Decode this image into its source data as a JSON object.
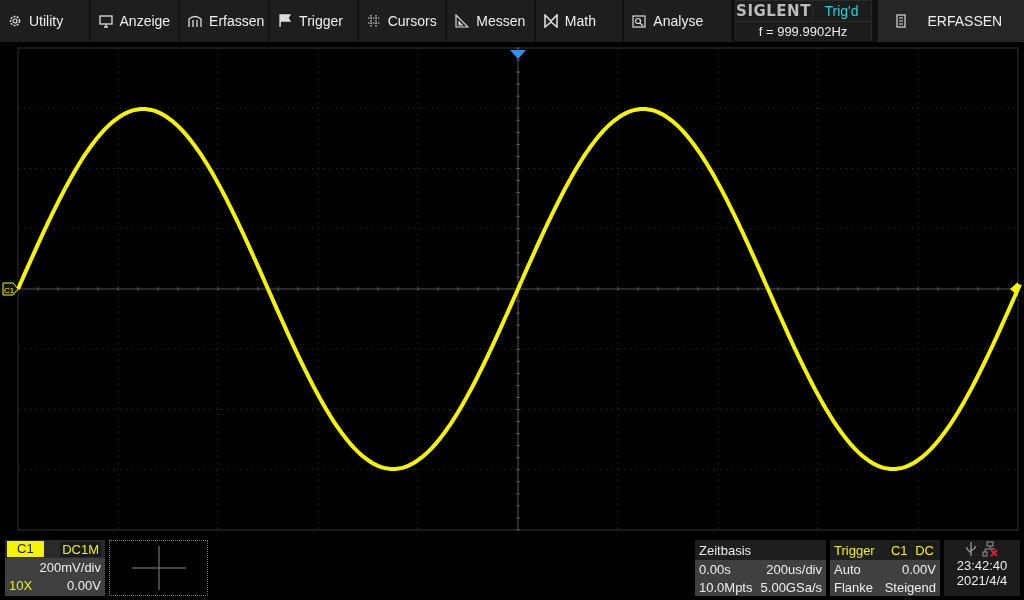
{
  "menu": [
    {
      "label": "Utility"
    },
    {
      "label": "Anzeige"
    },
    {
      "label": "Erfassen"
    },
    {
      "label": "Trigger"
    },
    {
      "label": "Cursors"
    },
    {
      "label": "Messen"
    },
    {
      "label": "Math"
    },
    {
      "label": "Analyse"
    }
  ],
  "brand": "SIGLENT",
  "trigger_status": "Trig'd",
  "frequency": "f = 999.9902Hz",
  "acquire_button": "ERFASSEN",
  "channel_marker": "C1",
  "channel": {
    "name": "C1",
    "coupling": "DC1M",
    "scale": "200mV/div",
    "probe": "10X",
    "offset": "0.00V"
  },
  "timebase": {
    "title": "Zeitbasis",
    "delay": "0.00s",
    "scale": "200us/div",
    "memory": "10.0Mpts",
    "sample_rate": "5.00GSa/s"
  },
  "trigger": {
    "title": "Trigger",
    "source": "C1",
    "coupling": "DC",
    "mode": "Auto",
    "level": "0.00V",
    "type": "Flanke",
    "slope": "Steigend"
  },
  "clock": {
    "time": "23:42:40",
    "date": "2021/4/4"
  }
}
